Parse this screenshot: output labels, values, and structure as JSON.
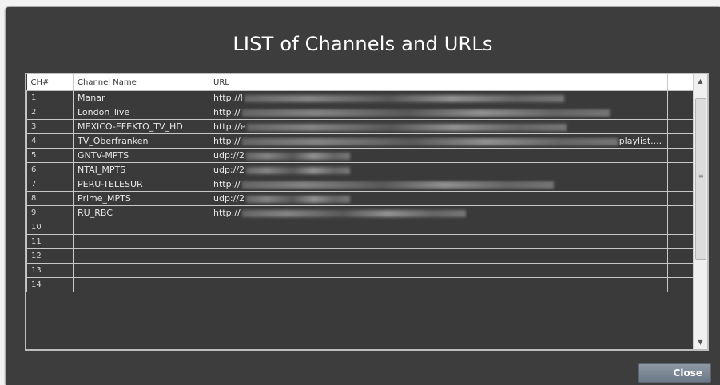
{
  "dialog": {
    "title": "LIST of Channels and URLs",
    "close_label": "Close"
  },
  "table": {
    "columns": [
      "CH#",
      "Channel Name",
      "URL",
      ""
    ],
    "rows": [
      {
        "num": "1",
        "name": "Manar",
        "url": "http://l",
        "url_suffix": ""
      },
      {
        "num": "2",
        "name": "London_live",
        "url": "http://",
        "url_suffix": ""
      },
      {
        "num": "3",
        "name": "MEXICO-EFEKTO_TV_HD",
        "url": "http://e",
        "url_suffix": ""
      },
      {
        "num": "4",
        "name": "TV_Oberfranken",
        "url": "http://",
        "url_suffix": "playlist...."
      },
      {
        "num": "5",
        "name": "GNTV-MPTS",
        "url": "udp://2",
        "url_suffix": ""
      },
      {
        "num": "6",
        "name": "NTAI_MPTS",
        "url": "udp://2",
        "url_suffix": ""
      },
      {
        "num": "7",
        "name": "PERU-TELESUR",
        "url": "http://",
        "url_suffix": ""
      },
      {
        "num": "8",
        "name": "Prime_MPTS",
        "url": "udp://2",
        "url_suffix": ""
      },
      {
        "num": "9",
        "name": "RU_RBC",
        "url": "http://",
        "url_suffix": ""
      },
      {
        "num": "10",
        "name": "",
        "url": "",
        "url_suffix": ""
      },
      {
        "num": "11",
        "name": "",
        "url": "",
        "url_suffix": ""
      },
      {
        "num": "12",
        "name": "",
        "url": "",
        "url_suffix": ""
      },
      {
        "num": "13",
        "name": "",
        "url": "",
        "url_suffix": ""
      },
      {
        "num": "14",
        "name": "",
        "url": "",
        "url_suffix": ""
      }
    ]
  },
  "scrollbar": {
    "up_icon": "triangle-up",
    "down_icon": "triangle-down",
    "grip_icon": "grip-lines"
  },
  "colors": {
    "dialog_bg": "#3d3d3d",
    "grid_line": "#c8c8c8",
    "button": "#7a8693"
  }
}
